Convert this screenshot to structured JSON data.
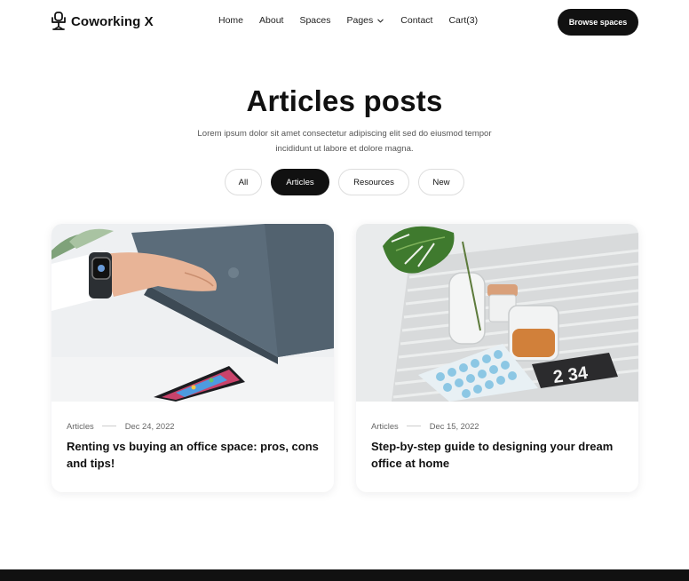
{
  "brand": {
    "name": "Coworking X"
  },
  "nav": {
    "items": [
      {
        "label": "Home"
      },
      {
        "label": "About"
      },
      {
        "label": "Spaces"
      },
      {
        "label": "Pages"
      },
      {
        "label": "Contact"
      },
      {
        "label": "Cart(3)"
      }
    ],
    "cta": "Browse spaces"
  },
  "hero": {
    "title": "Articles posts",
    "subtitle": "Lorem ipsum dolor sit amet consectetur adipiscing elit sed do eiusmod tempor incididunt ut labore et dolore magna."
  },
  "filters": {
    "items": [
      {
        "label": "All"
      },
      {
        "label": "Articles"
      },
      {
        "label": "Resources"
      },
      {
        "label": "New"
      }
    ],
    "active": "Articles"
  },
  "articles": [
    {
      "category": "Articles",
      "date": "Dec 24, 2022",
      "title": "Renting vs buying an office space: pros, cons and tips!",
      "image": "laptop-watch-phone-photo"
    },
    {
      "category": "Articles",
      "date": "Dec 15, 2022",
      "title": "Step-by-step guide to designing your dream office at home",
      "image": "keyboard-tea-plant-photo",
      "clock_text": "2 34"
    }
  ],
  "colors": {
    "primary": "#111111",
    "background": "#ffffff",
    "text_muted": "#555555"
  }
}
